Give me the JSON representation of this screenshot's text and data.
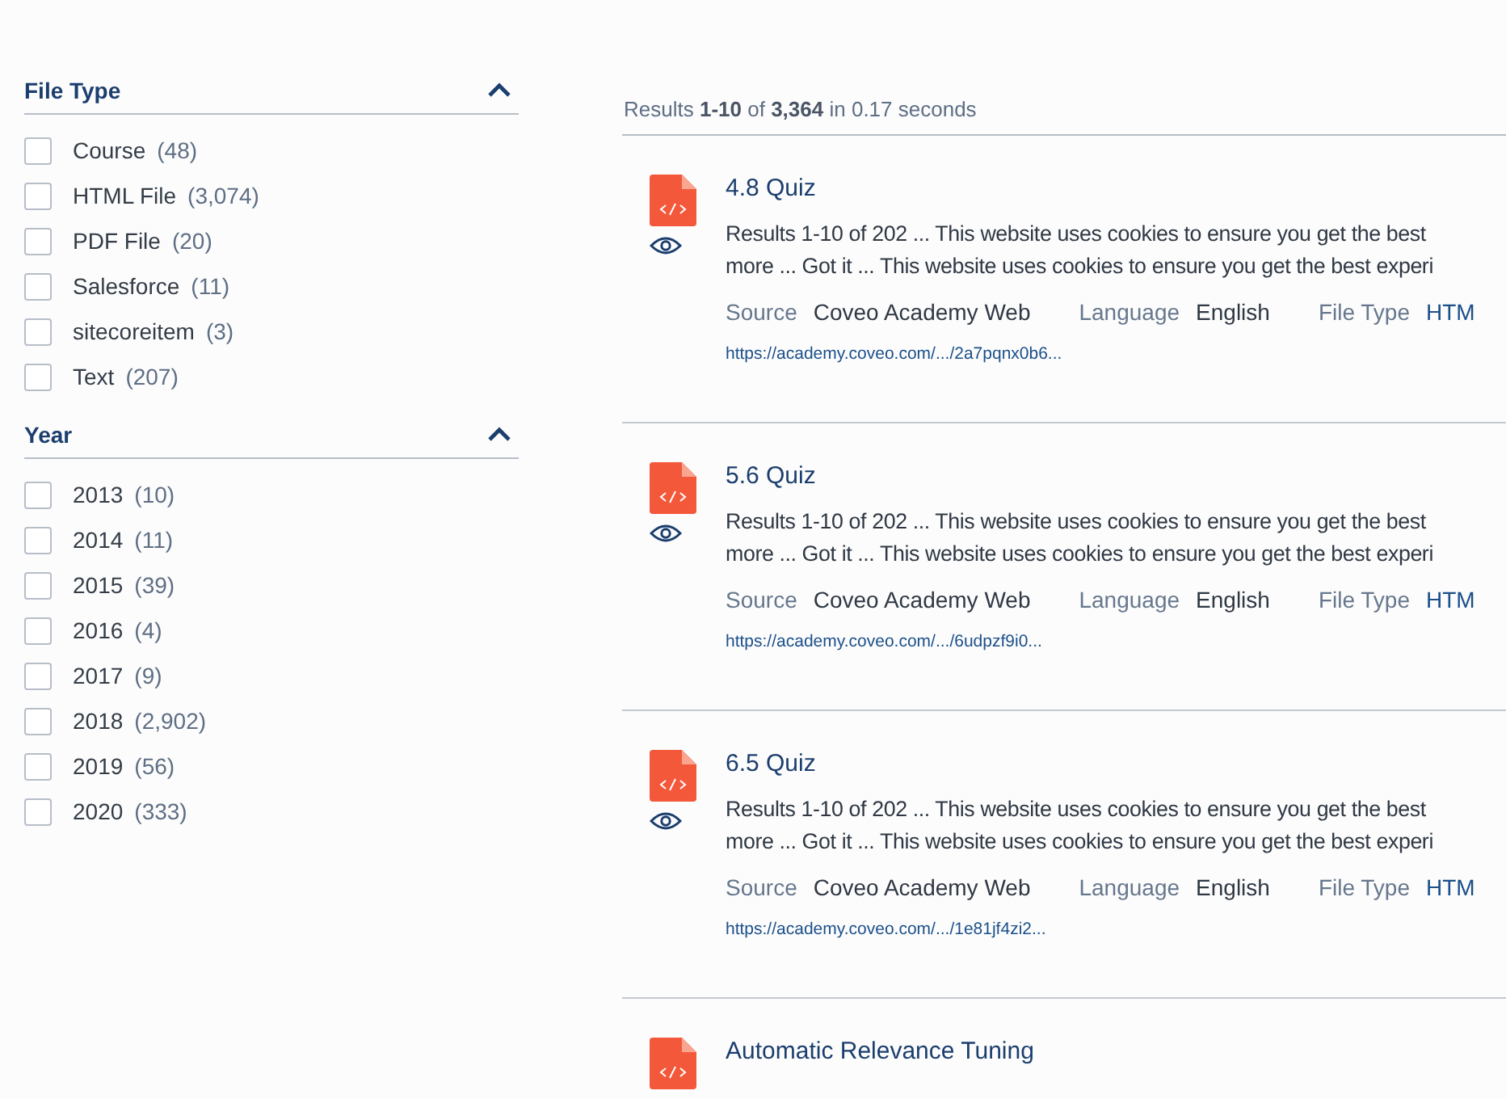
{
  "facets": [
    {
      "title": "File Type",
      "expanded": true,
      "values": [
        {
          "label": "Course",
          "count": "(48)",
          "checked": false
        },
        {
          "label": "HTML File",
          "count": "(3,074)",
          "checked": false
        },
        {
          "label": "PDF File",
          "count": "(20)",
          "checked": false
        },
        {
          "label": "Salesforce",
          "count": "(11)",
          "checked": false
        },
        {
          "label": "sitecoreitem",
          "count": "(3)",
          "checked": false
        },
        {
          "label": "Text",
          "count": "(207)",
          "checked": false
        }
      ]
    },
    {
      "title": "Year",
      "expanded": true,
      "values": [
        {
          "label": "2013",
          "count": "(10)",
          "checked": false
        },
        {
          "label": "2014",
          "count": "(11)",
          "checked": false
        },
        {
          "label": "2015",
          "count": "(39)",
          "checked": false
        },
        {
          "label": "2016",
          "count": "(4)",
          "checked": false
        },
        {
          "label": "2017",
          "count": "(9)",
          "checked": false
        },
        {
          "label": "2018",
          "count": "(2,902)",
          "checked": false
        },
        {
          "label": "2019",
          "count": "(56)",
          "checked": false
        },
        {
          "label": "2020",
          "count": "(333)",
          "checked": false
        }
      ]
    }
  ],
  "summary": "Results **1-10** of **3,364** in 0.17 seconds",
  "results": [
    {
      "title": "4.8 Quiz",
      "snippet_lines": [
        "Results 1-10 of 202 ... This website uses cookies to ensure you get the best",
        "more ... Got it ... This website uses cookies to ensure you get the best experi"
      ],
      "fields": [
        {
          "label": "Source",
          "value": "Coveo Academy Web",
          "kind": "text"
        },
        {
          "label": "Language",
          "value": "English",
          "kind": "text"
        },
        {
          "label": "File Type",
          "value": "HTM",
          "kind": "link"
        }
      ],
      "url": "https://academy.coveo.com/.../2a7pqnx0b6..."
    },
    {
      "title": "5.6 Quiz",
      "snippet_lines": [
        "Results 1-10 of 202 ... This website uses cookies to ensure you get the best",
        "more ... Got it ... This website uses cookies to ensure you get the best experi"
      ],
      "fields": [
        {
          "label": "Source",
          "value": "Coveo Academy Web",
          "kind": "text"
        },
        {
          "label": "Language",
          "value": "English",
          "kind": "text"
        },
        {
          "label": "File Type",
          "value": "HTM",
          "kind": "link"
        }
      ],
      "url": "https://academy.coveo.com/.../6udpzf9i0..."
    },
    {
      "title": "6.5 Quiz",
      "snippet_lines": [
        "Results 1-10 of 202 ... This website uses cookies to ensure you get the best",
        "more ... Got it ... This website uses cookies to ensure you get the best experi"
      ],
      "fields": [
        {
          "label": "Source",
          "value": "Coveo Academy Web",
          "kind": "text"
        },
        {
          "label": "Language",
          "value": "English",
          "kind": "text"
        },
        {
          "label": "File Type",
          "value": "HTM",
          "kind": "link"
        }
      ],
      "url": "https://academy.coveo.com/.../1e81jf4zi2..."
    },
    {
      "title": "Automatic Relevance Tuning"
    }
  ]
}
